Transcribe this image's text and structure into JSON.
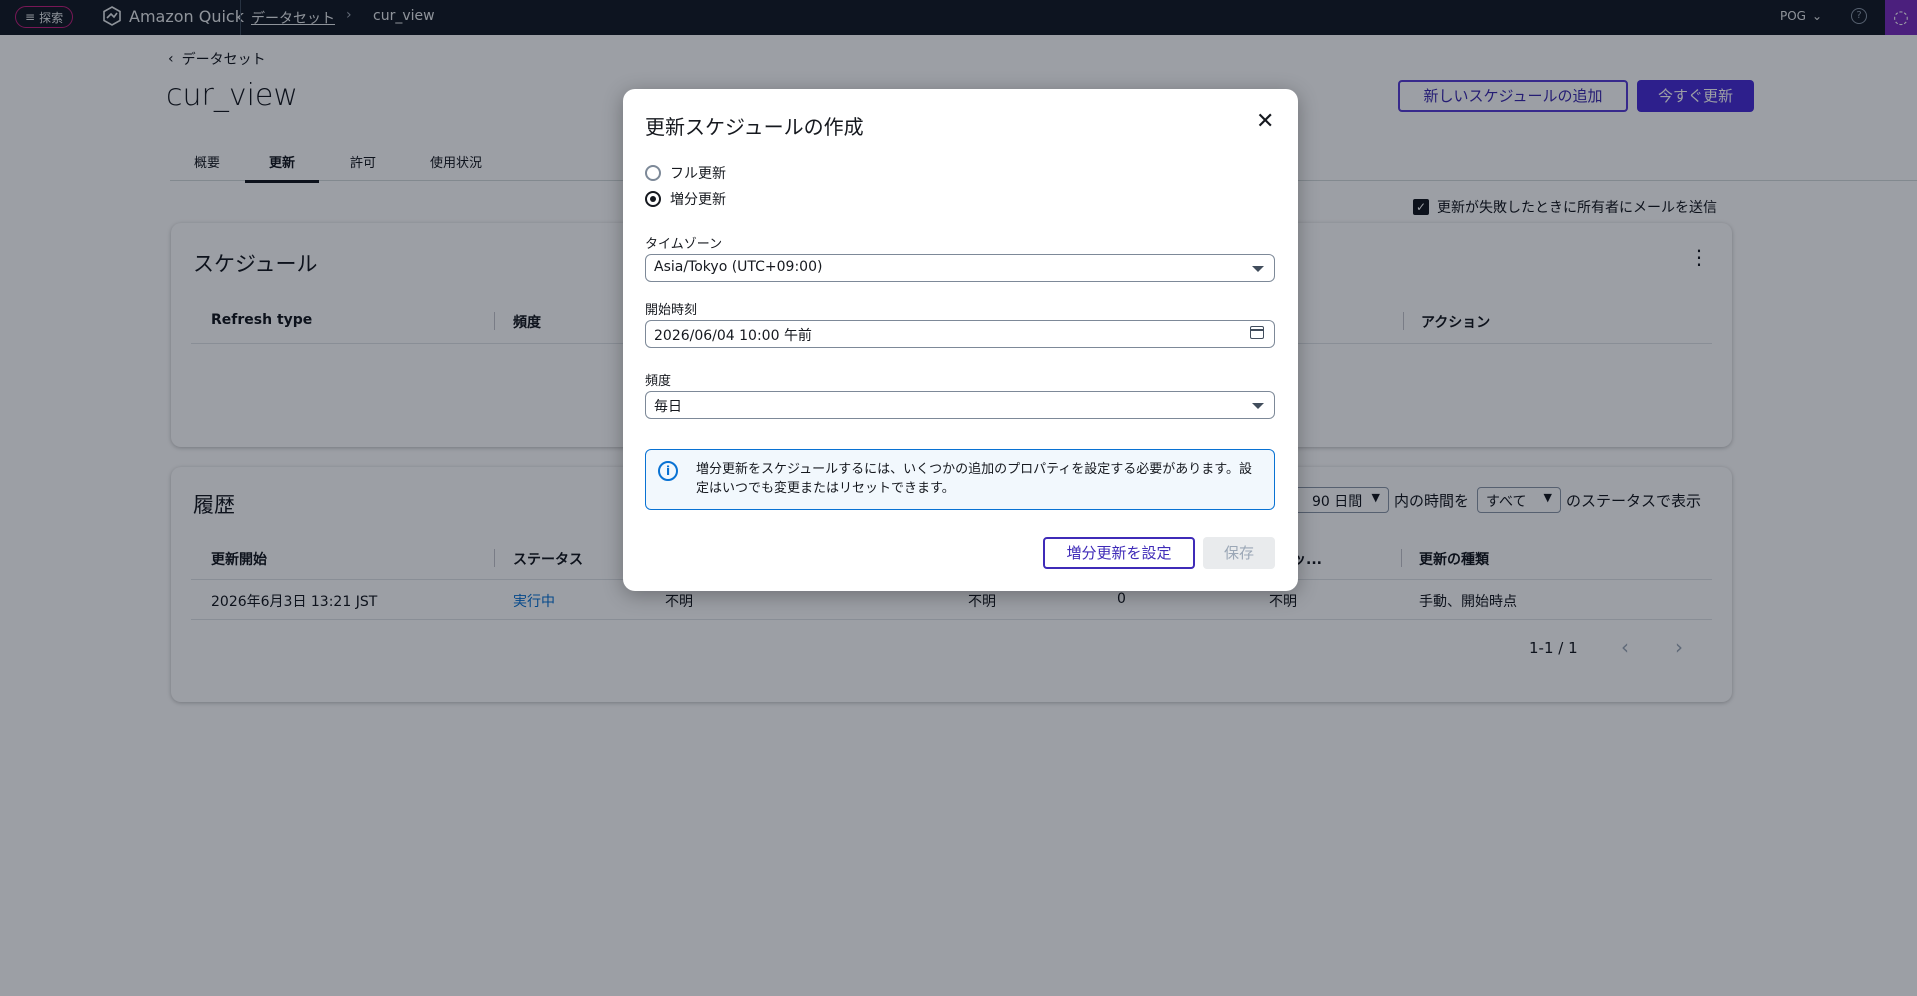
{
  "topbar": {
    "explore_label": "探索",
    "brand_name": "Amazon Quick",
    "breadcrumb_datasets": "データセット",
    "breadcrumb_current": "cur_view",
    "user_name": "POG"
  },
  "page": {
    "back_label": "データセット",
    "title": "cur_view",
    "add_schedule_label": "新しいスケジュールの追加",
    "refresh_now_label": "今すぐ更新",
    "tabs": [
      {
        "label": "概要"
      },
      {
        "label": "更新",
        "active": true
      },
      {
        "label": "許可"
      },
      {
        "label": "使用状況"
      }
    ],
    "email_on_failure_label": "更新が失敗したときに所有者にメールを送信"
  },
  "schedule_card": {
    "title": "スケジュール",
    "columns": [
      "Refresh type",
      "頻度",
      "アクション"
    ]
  },
  "history_card": {
    "title": "履歴",
    "filter_period_value": "90 日間",
    "filter_middle_text": "内の時間を",
    "filter_status_value": "すべて",
    "filter_suffix_text": "のステータスで表示",
    "columns": [
      "更新開始",
      "ステータス",
      "タセッ...",
      "更新の種類"
    ],
    "rows": [
      {
        "start": "2026年6月3日 13:21 JST",
        "status": "実行中",
        "col3": "不明",
        "col4": "不明",
        "col5": "0",
        "col6": "不明",
        "type": "手動、開始時点"
      }
    ],
    "pagination": "1-1 / 1"
  },
  "modal": {
    "title": "更新スケジュールの作成",
    "radio_full": "フル更新",
    "radio_incremental": "増分更新",
    "selected_radio": "増分更新",
    "timezone_label": "タイムゾーン",
    "timezone_value": "Asia/Tokyo (UTC+09:00)",
    "start_time_label": "開始時刻",
    "start_time_value": "2026/06/04 10:00 午前",
    "frequency_label": "頻度",
    "frequency_value": "毎日",
    "info_text": "増分更新をスケジュールするには、いくつかの追加のプロパティを設定する必要があります。設定はいつでも変更またはリセットできます。",
    "configure_button": "増分更新を設定",
    "save_button": "保存"
  },
  "colors": {
    "topbar_bg": "#161d26",
    "primary": "#4b2fd6",
    "link": "#0972d3",
    "overlay": "rgba(0,7,22,0.39)"
  }
}
